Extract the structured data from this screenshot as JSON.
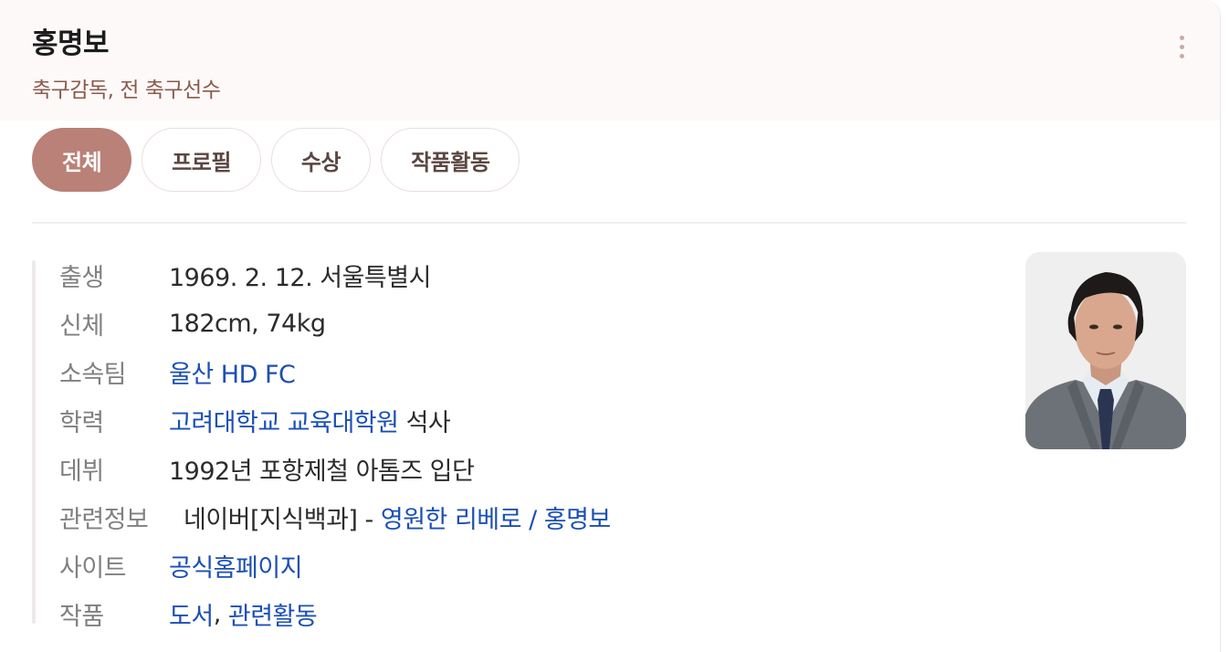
{
  "header": {
    "name": "홍명보",
    "subtitle": "축구감독, 전 축구선수"
  },
  "tabs": [
    "전체",
    "프로필",
    "수상",
    "작품활동"
  ],
  "active_tab": "전체",
  "info": {
    "birth": {
      "label": "출생",
      "value": "1969. 2. 12. 서울특별시"
    },
    "body": {
      "label": "신체",
      "value": "182cm, 74kg"
    },
    "team": {
      "label": "소속팀",
      "link": "울산 HD FC"
    },
    "education": {
      "label": "학력",
      "link": "고려대학교 교육대학원",
      "suffix": " 석사"
    },
    "debut": {
      "label": "데뷔",
      "value": "1992년 포항제철 아톰즈 입단"
    },
    "related": {
      "label": "관련정보",
      "prefix": "네이버[지식백과] - ",
      "link": "영원한 리베로 / 홍명보"
    },
    "site": {
      "label": "사이트",
      "link": "공식홈페이지"
    },
    "works": {
      "label": "작품",
      "link1": "도서",
      "sep": ", ",
      "link2": "관련활동"
    }
  },
  "colors": {
    "accent": "#b98177",
    "subtitle": "#8a5a4c",
    "link": "#1b4fb5",
    "label": "#808080"
  }
}
